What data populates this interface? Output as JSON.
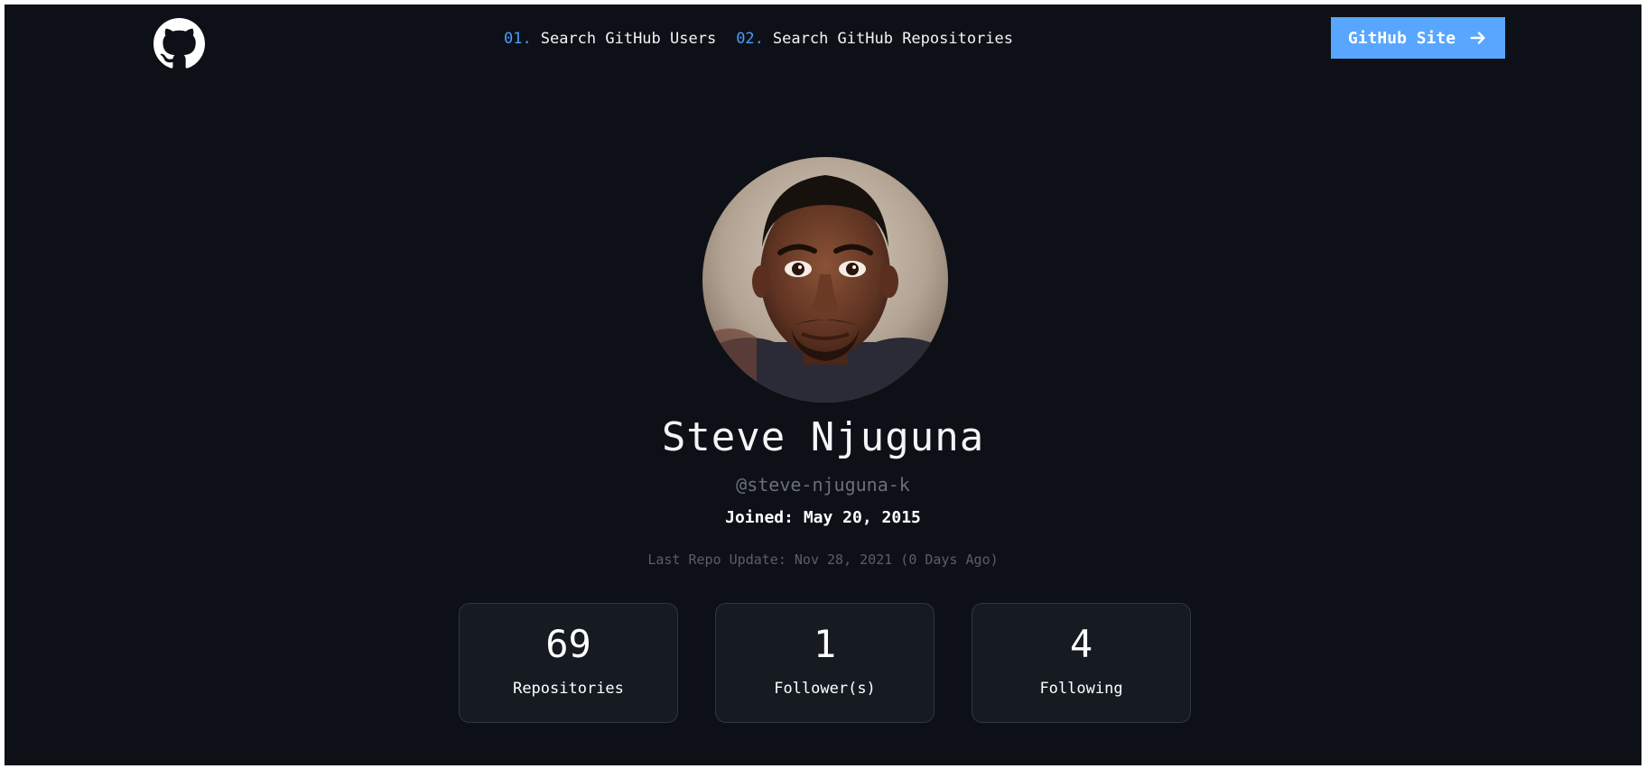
{
  "header": {
    "nav": [
      {
        "number": "01.",
        "label": "Search GitHub Users"
      },
      {
        "number": "02.",
        "label": "Search GitHub Repositories"
      }
    ],
    "cta_label": "GitHub Site"
  },
  "icons": {
    "logo": "github-icon",
    "cta": "arrow-right-icon"
  },
  "profile": {
    "name": "Steve Njuguna",
    "handle": "@steve-njuguna-k",
    "joined": "Joined: May 20, 2015",
    "last_update": "Last Repo Update: Nov 28, 2021 (0 Days Ago)"
  },
  "stats": [
    {
      "value": "69",
      "label": "Repositories"
    },
    {
      "value": "1",
      "label": "Follower(s)"
    },
    {
      "value": "4",
      "label": "Following"
    }
  ],
  "colors": {
    "background": "#0d1017",
    "accent": "#58a6ff",
    "nav_number": "#4a9eff",
    "card": "#161b22",
    "muted_text": "#6b6f77"
  }
}
